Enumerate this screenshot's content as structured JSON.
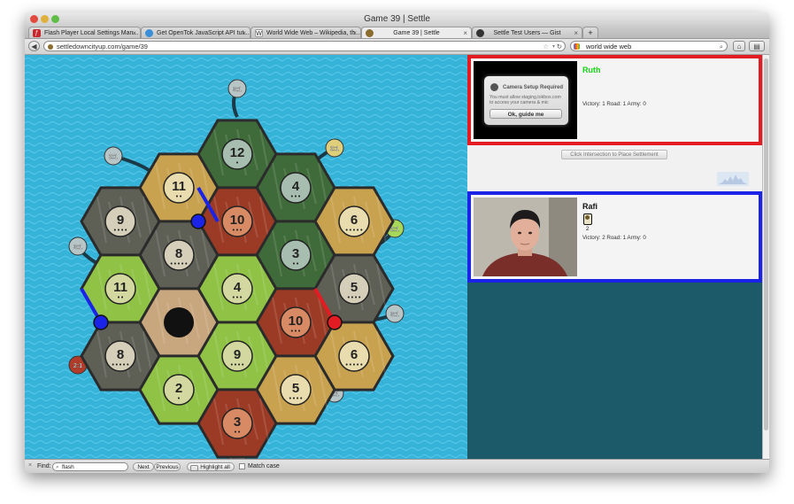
{
  "window": {
    "title": "Game 39 | Settle"
  },
  "tabs": [
    {
      "label": "Flash Player Local Settings Man...",
      "icon": "flash-icon",
      "color": "#c9262c"
    },
    {
      "label": "Get OpenTok JavaScript API tut...",
      "icon": "opentok-icon",
      "color": "#3a8fd8"
    },
    {
      "label": "World Wide Web – Wikipedia, th...",
      "icon": "wikipedia-icon",
      "color": "#ffffff"
    },
    {
      "label": "Game 39 | Settle",
      "icon": "settle-icon",
      "color": "#8a6d2f"
    },
    {
      "label": "Settle Test Users — Gist",
      "icon": "github-icon",
      "color": "#333333"
    }
  ],
  "nav": {
    "url": "settledowncityup.com/game/39",
    "search_value": "world wide web"
  },
  "board": {
    "hexes": [
      {
        "terrain": "forest",
        "number": "12",
        "dots": "•"
      },
      {
        "terrain": "wheat",
        "number": "11",
        "dots": "••"
      },
      {
        "terrain": "forest",
        "number": "4",
        "dots": "•••"
      },
      {
        "terrain": "stone",
        "number": "9",
        "dots": "••••"
      },
      {
        "terrain": "brick",
        "number": "10",
        "dots": "•••"
      },
      {
        "terrain": "wheat",
        "number": "6",
        "dots": "•••••"
      },
      {
        "terrain": "stone",
        "number": "8",
        "dots": "•••••"
      },
      {
        "terrain": "forest",
        "number": "3",
        "dots": "••"
      },
      {
        "terrain": "pasture",
        "number": "11",
        "dots": "••"
      },
      {
        "terrain": "pasture",
        "number": "4",
        "dots": "•••"
      },
      {
        "terrain": "stone",
        "number": "5",
        "dots": "••••"
      },
      {
        "terrain": "desert",
        "number": "",
        "dots": ""
      },
      {
        "terrain": "brick",
        "number": "10",
        "dots": "•••"
      },
      {
        "terrain": "stone",
        "number": "8",
        "dots": "•••••"
      },
      {
        "terrain": "pasture",
        "number": "9",
        "dots": "••••"
      },
      {
        "terrain": "wheat",
        "number": "6",
        "dots": "•••••"
      },
      {
        "terrain": "pasture",
        "number": "2",
        "dots": "•"
      },
      {
        "terrain": "wheat",
        "number": "5",
        "dots": "••••"
      },
      {
        "terrain": "brick",
        "number": "3",
        "dots": "••"
      }
    ],
    "ports": [
      {
        "label": "3:1",
        "kind": "generic"
      },
      {
        "label": "2:1",
        "kind": "generic"
      },
      {
        "label": "2:1",
        "kind": "wheat"
      },
      {
        "label": "2:1",
        "kind": "pasture"
      },
      {
        "label": "3:1",
        "kind": "generic"
      },
      {
        "label": "3:1",
        "kind": "generic"
      },
      {
        "label": "2:1",
        "kind": "brick"
      },
      {
        "label": "2:1",
        "kind": "generic"
      },
      {
        "label": "3:1",
        "kind": "generic"
      }
    ],
    "colors": {
      "sea": "#36b3d9",
      "player_blue": "#1a23e6",
      "player_red": "#e31b23"
    }
  },
  "players": [
    {
      "name": "Ruth",
      "name_color": "#17d317",
      "stats": "Victory: 1   Road: 1   Army: 0",
      "dialog": {
        "title": "Camera Setup Required",
        "text": "You must allow staging.tokbox.com to access your camera & mic",
        "button": "Ok, guide me"
      }
    },
    {
      "name": "Rafi",
      "name_color": "#111111",
      "card_count": "2",
      "stats": "Victory: 2   Road: 1   Army: 0"
    }
  ],
  "action": {
    "button_label": "Click Intersection to Place Settlement"
  },
  "findbar": {
    "find_label": "Find:",
    "find_value": "flash",
    "next_label": "Next",
    "previous_label": "Previous",
    "highlight_label": "Highlight all",
    "match_case_label": "Match case"
  }
}
